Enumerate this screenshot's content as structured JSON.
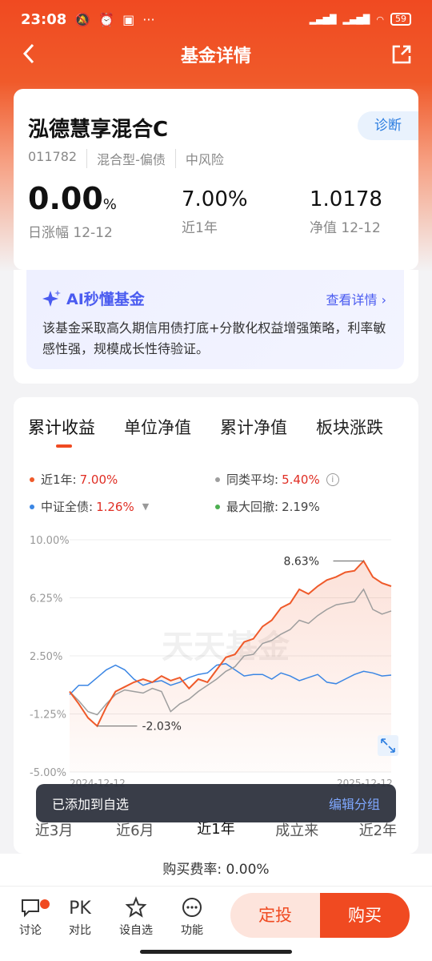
{
  "status_bar": {
    "time": "23:08",
    "battery": "59"
  },
  "nav": {
    "title": "基金详情"
  },
  "fund": {
    "name": "泓德慧享混合C",
    "diagnose": "诊断",
    "code": "011782",
    "type": "混合型-偏债",
    "risk": "中风险",
    "daily_change": "0.00",
    "daily_change_unit": "%",
    "daily_change_label": "日涨幅 12-12",
    "year_return": "7.00%",
    "year_return_label": "近1年",
    "nav_value": "1.0178",
    "nav_label": "净值 12-12"
  },
  "ai": {
    "title": "AI秒懂基金",
    "link": "查看详情",
    "text": "该基金采取高久期信用债打底+分散化权益增强策略，利率敏感性强，规模成长性待验证。"
  },
  "chart_tabs": [
    "累计收益",
    "单位净值",
    "累计净值",
    "板块涨跌"
  ],
  "legend": {
    "fund_label": "近1年:",
    "fund_value": "7.00%",
    "peer_label": "同类平均:",
    "peer_value": "5.40%",
    "index_label": "中证全债:",
    "index_value": "1.26%",
    "drawdown_label": "最大回撤:",
    "drawdown_value": "2.19%"
  },
  "chart_data": {
    "type": "line",
    "ylim": [
      -5.0,
      10.0
    ],
    "y_ticks": [
      "10.00%",
      "6.25%",
      "2.50%",
      "-1.25%",
      "-5.00%"
    ],
    "x_ticks": [
      "2024-12-12",
      "2025-12-12"
    ],
    "watermark": "天天基金",
    "annotations": {
      "max": "8.63%",
      "min": "-2.03%"
    },
    "series": [
      {
        "name": "近1年",
        "color": "#ef5a2a",
        "values": [
          0.2,
          -0.6,
          -1.5,
          -2.03,
          -0.8,
          0.2,
          0.5,
          0.8,
          1.0,
          0.8,
          1.2,
          0.9,
          1.1,
          0.4,
          1.0,
          0.8,
          1.6,
          2.4,
          2.6,
          3.4,
          3.6,
          4.4,
          4.8,
          5.6,
          5.9,
          6.8,
          6.5,
          7.0,
          7.4,
          7.6,
          7.9,
          8.0,
          8.63,
          7.6,
          7.2,
          7.0
        ]
      },
      {
        "name": "同类平均",
        "color": "#9e9e9e",
        "values": [
          0.2,
          -0.4,
          -1.1,
          -1.3,
          -0.6,
          0.0,
          0.3,
          0.2,
          0.1,
          0.4,
          0.2,
          -1.1,
          -0.6,
          -0.3,
          0.2,
          0.6,
          1.0,
          1.5,
          1.8,
          2.5,
          2.6,
          3.3,
          3.5,
          3.9,
          4.2,
          4.8,
          4.6,
          5.1,
          5.5,
          5.8,
          5.9,
          6.0,
          6.8,
          5.5,
          5.2,
          5.4
        ]
      },
      {
        "name": "中证全债",
        "color": "#3b86e4",
        "values": [
          0.0,
          0.6,
          0.6,
          1.1,
          1.6,
          1.9,
          1.6,
          1.0,
          0.6,
          0.8,
          0.9,
          0.6,
          0.8,
          1.1,
          1.3,
          1.4,
          1.9,
          2.0,
          1.6,
          1.2,
          1.3,
          1.3,
          1.0,
          1.4,
          1.2,
          0.9,
          1.1,
          1.3,
          0.8,
          0.7,
          1.0,
          1.3,
          1.5,
          1.4,
          1.2,
          1.26
        ]
      }
    ]
  },
  "ranges": [
    "近3月",
    "近6月",
    "近1年",
    "成立来",
    "近2年"
  ],
  "toast": {
    "text": "已添加到自选",
    "action": "编辑分组"
  },
  "fee": "购买费率: 0.00%",
  "bottom_nav": {
    "discuss": "讨论",
    "pk_icon": "PK",
    "compare": "对比",
    "watchlist": "设自选",
    "functions": "功能",
    "fixed": "定投",
    "buy": "购买"
  }
}
